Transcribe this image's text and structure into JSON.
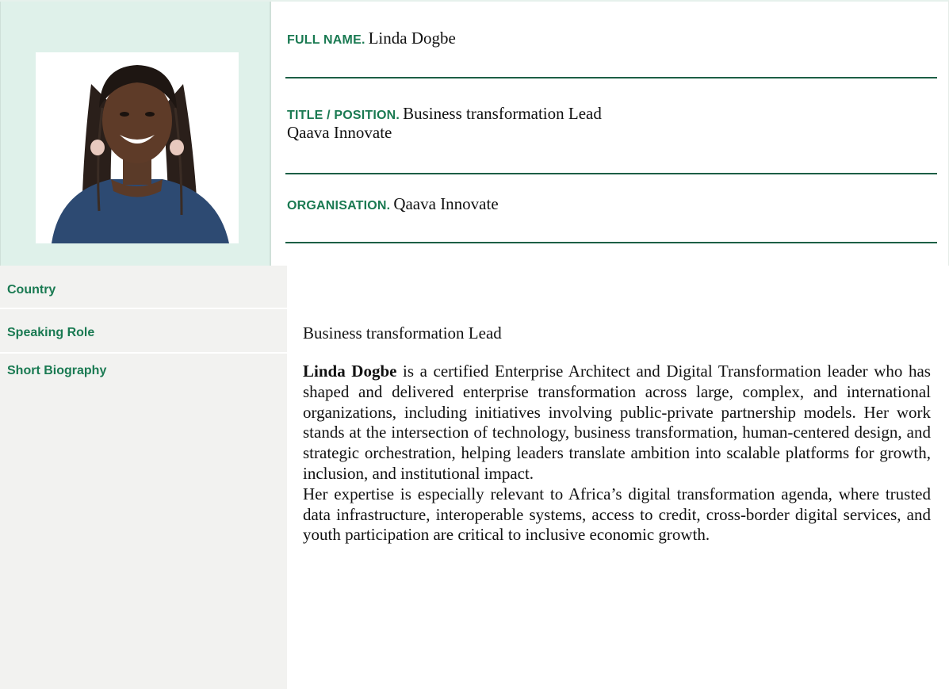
{
  "profile": {
    "full_name_label": "FULL NAME.",
    "full_name": "Linda Dogbe",
    "title_label": "TITLE / POSITION.",
    "title_line1": "Business transformation Lead",
    "title_line2": "Qaava Innovate",
    "organisation_label": "ORGANISATION.",
    "organisation": "Qaava Innovate"
  },
  "details": {
    "country_label": "Country",
    "country_value": "",
    "speaking_role_label": "Speaking Role",
    "speaking_role_value": "Business transformation Lead",
    "bio_label": "Short Biography",
    "bio_name": "Linda Dogbe",
    "bio_paragraph1_rest": " is a certified Enterprise Architect and Digital Transformation leader who has shaped and delivered enterprise transformation across large, complex, and international organizations, including initiatives involving public-private partnership models. Her work stands at the intersection of technology, business transformation, human-centered design, and strategic orchestration, helping leaders translate ambition into scalable platforms for growth, inclusion, and institutional impact.",
    "bio_paragraph2": "Her expertise is especially relevant to Africa’s digital transformation agenda, where trusted data infrastructure, interoperable systems, access to credit, cross-border digital services, and youth participation are critical to inclusive economic growth."
  }
}
